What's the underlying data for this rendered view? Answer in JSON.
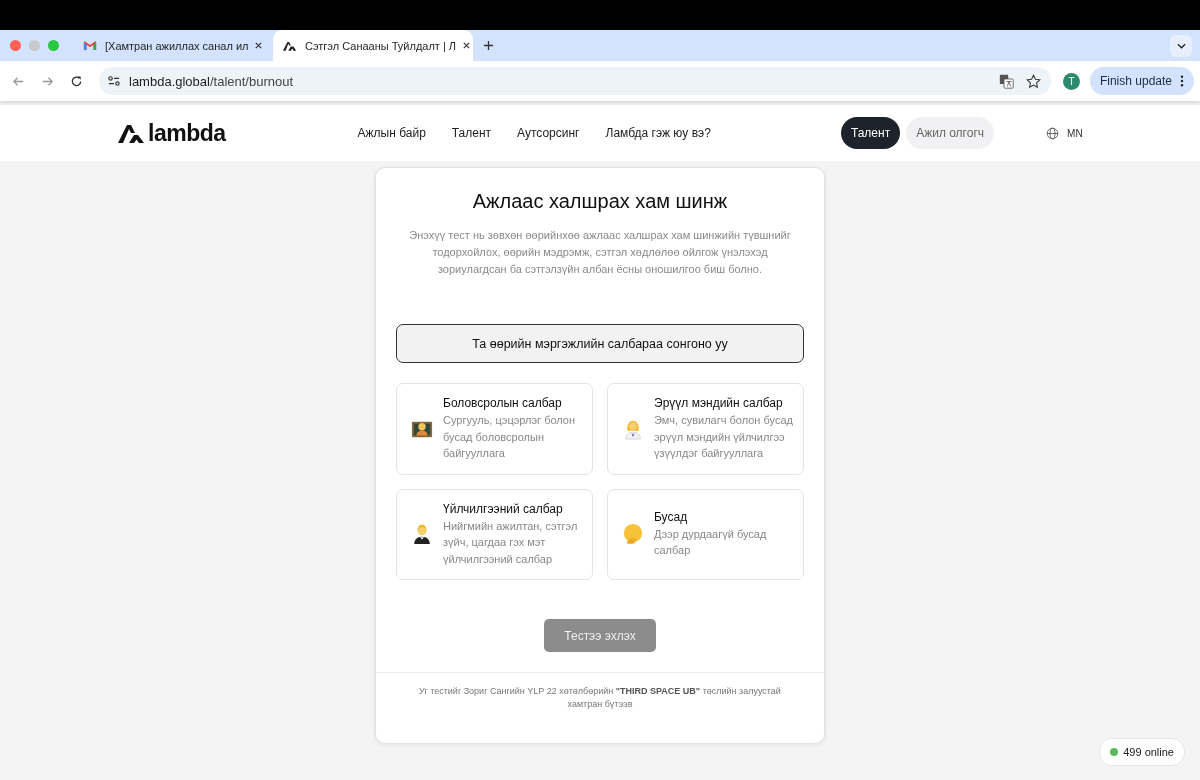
{
  "browser": {
    "tabs": [
      {
        "title": "[Хамтран ажиллах санал ил",
        "kind": "mail",
        "selected": false
      },
      {
        "title": "Сэтгэл Санааны Туйлдалт | Л",
        "kind": "site",
        "selected": true
      }
    ],
    "address": {
      "host": "lambda.global",
      "path": "/talent/burnout"
    },
    "profile_initial": "T",
    "update_button": "Finish update"
  },
  "header": {
    "logo": "lambda",
    "nav": [
      "Ажлын байр",
      "Талент",
      "Аутсорсинг",
      "Ламбда гэж юу вэ?"
    ],
    "switch": [
      {
        "label": "Талент",
        "selected": true
      },
      {
        "label": "Ажил олгогч",
        "selected": false
      }
    ],
    "language": "MN"
  },
  "card": {
    "title": "Ажлаас халшрах хам шинж",
    "description": "Энэхүү тест нь зөвхөн өөрийнхөө ажлаас халшрах хам шинжийн түвшнийг тодорхойлох, өөрийн мэдрэмж, сэтгэл хөдлөлөө ойлгож үнэлэхэд зориулагдсан ба сэтгэлзүйн албан ёсны оношилгоо биш болно.",
    "prompt": "Та өөрийн мэргэжлийн салбараа сонгоно уу",
    "sectors": [
      {
        "kind": "teacher",
        "title": "Боловсролын салбар",
        "description": "Сургууль, цэцэрлэг болон бусад боловсролын байгууллага",
        "selected": false
      },
      {
        "kind": "health",
        "title": "Эрүүл мэндийн салбар",
        "description": "Эмч, сувилагч болон бусад эрүүл мэндийн үйлчилгээ үзүүлдэг байгууллага",
        "selected": false
      },
      {
        "kind": "service",
        "title": "Үйлчилгээний салбар",
        "description": "Нийгмийн ажилтан, сэтгэл зүйч, цагдаа гэх мэт үйлчилгээний салбар",
        "selected": false
      },
      {
        "kind": "other",
        "title": "Бусад",
        "description": "Дээр дурдаагүй бусад салбар",
        "selected": false
      }
    ],
    "start_button": {
      "label": "Тестээ эхлэх",
      "disabled": true
    },
    "footer_note": "Уг тестийг Зориг Сангийн YLP 22 хөтөлбөрийн **\"THIRD SPACE UB\"** төслийн залуустай хамтран бүтээв"
  },
  "online_badge": {
    "text": "499 online",
    "color": "#5cb85c"
  }
}
